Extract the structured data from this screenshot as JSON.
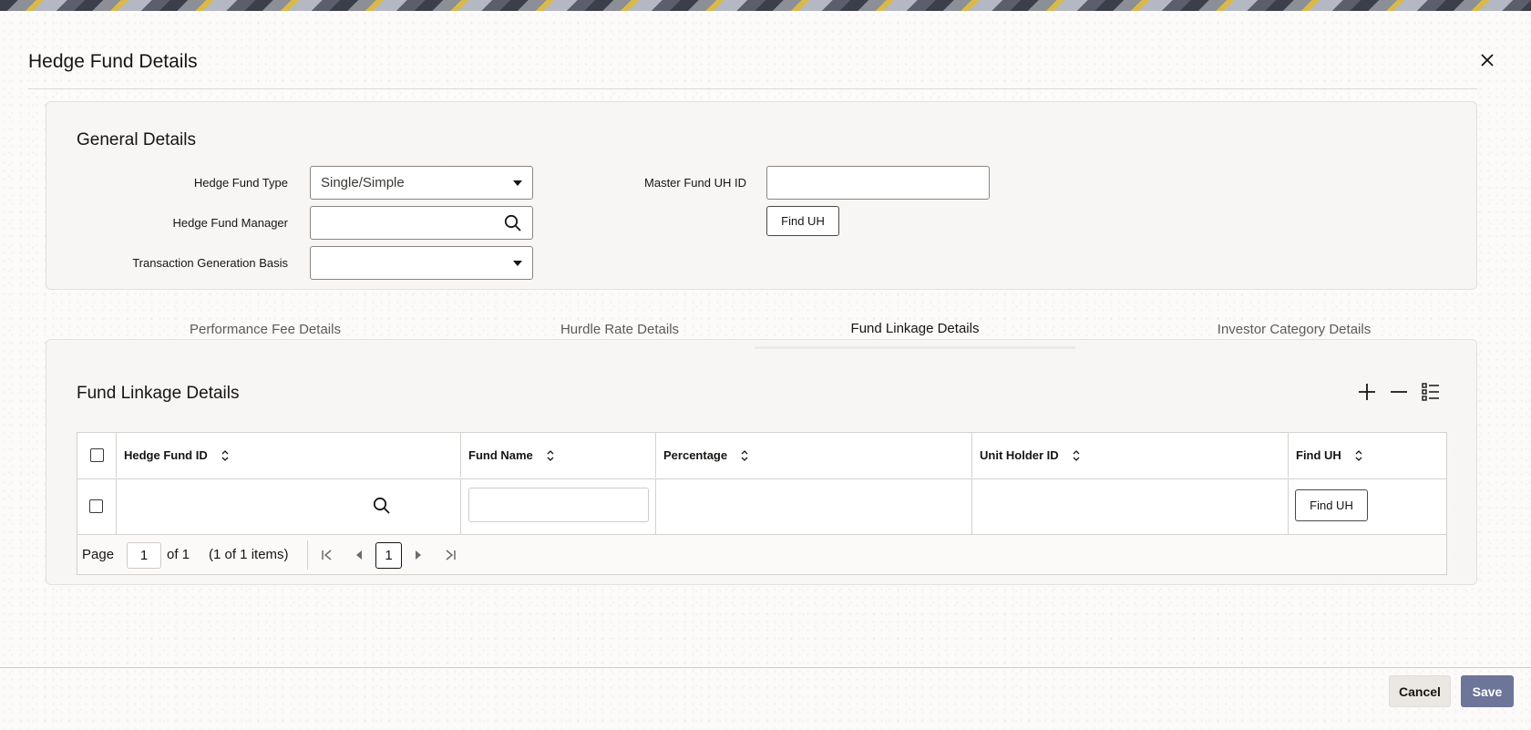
{
  "dialog": {
    "title": "Hedge Fund Details"
  },
  "general": {
    "title": "General Details",
    "hedge_fund_type_label": "Hedge Fund Type",
    "hedge_fund_type_value": "Single/Simple",
    "hedge_fund_manager_label": "Hedge Fund Manager",
    "hedge_fund_manager_value": "",
    "transaction_basis_label": "Transaction Generation Basis",
    "transaction_basis_value": "",
    "master_fund_uh_label": "Master Fund UH ID",
    "master_fund_uh_value": "",
    "find_uh_label": "Find UH"
  },
  "tabs": [
    {
      "label": "Performance Fee Details",
      "active": false
    },
    {
      "label": "Hurdle Rate Details",
      "active": false
    },
    {
      "label": "Fund Linkage Details",
      "active": true
    },
    {
      "label": "Investor Category Details",
      "active": false
    }
  ],
  "linkage": {
    "title": "Fund Linkage Details",
    "columns": [
      "Hedge Fund ID",
      "Fund Name",
      "Percentage",
      "Unit Holder ID",
      "Find UH"
    ],
    "rows": [
      {
        "hedge_fund_id": "",
        "fund_name": "",
        "percentage": "",
        "unit_holder_id": "",
        "find_uh_label": "Find UH"
      }
    ],
    "pager": {
      "page_label": "Page",
      "page_value": "1",
      "of_text": "of 1",
      "items_text": "(1 of 1 items)",
      "current_page": "1"
    }
  },
  "footer": {
    "cancel_label": "Cancel",
    "save_label": "Save"
  },
  "colors": {
    "accent": "#5b5f82",
    "save_button": "#6d7599"
  }
}
